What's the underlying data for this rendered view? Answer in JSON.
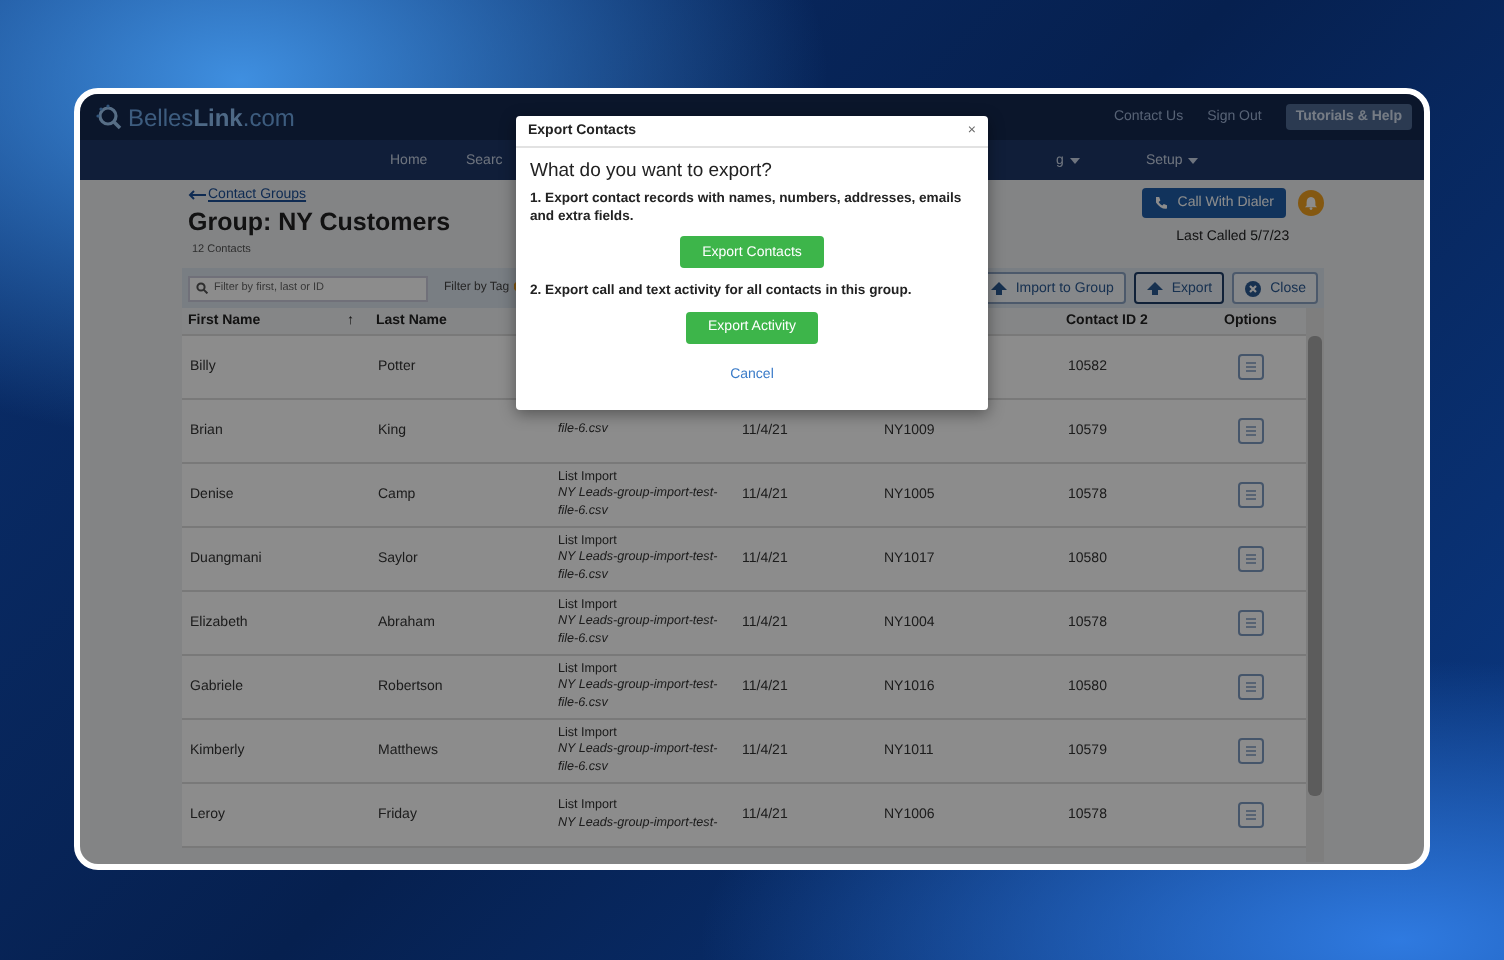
{
  "header": {
    "logo": "Belles**Link**.com",
    "links": [
      "Contact Us",
      "Sign Out"
    ],
    "help_button": "Tutorials & Help"
  },
  "nav": [
    {
      "label": "Home",
      "dropdown": false
    },
    {
      "label": "Searc",
      "dropdown": false
    },
    {
      "label": "g",
      "dropdown": true
    },
    {
      "label": "Setup",
      "dropdown": true
    }
  ],
  "page": {
    "back_link": "Contact Groups",
    "title": "Group: NY Customers",
    "count": "12 Contacts",
    "dialer_button": "Call With Dialer",
    "last_called": "Last Called 5/7/23"
  },
  "toolbar": {
    "search": {
      "placeholder": "Filter by first, last or ID"
    },
    "tag_filter": "Filter by Tag",
    "buttons": [
      {
        "kind": "import",
        "label": "Import to Group",
        "selected": false
      },
      {
        "kind": "export",
        "label": "Export",
        "selected": true
      },
      {
        "kind": "close",
        "label": "Close",
        "selected": false
      }
    ]
  },
  "table": {
    "columns": {
      "first_name": "First Name",
      "sort_indicator": "↑",
      "last_name": "Last Name",
      "contact_id_2": "Contact ID 2",
      "options": "Options"
    },
    "rows": [
      {
        "first_name": "Billy",
        "last_name": "Potter",
        "contact_id_2": "10582"
      },
      {
        "first_name": "Brian",
        "last_name": "King",
        "source_file": "file-6.csv",
        "date": "11/4/21",
        "id": "NY1009",
        "contact_id_2": "10579"
      },
      {
        "first_name": "Denise",
        "last_name": "Camp",
        "source": "List Import",
        "source_file": "NY Leads-group-import-test-file-6.csv",
        "date": "11/4/21",
        "id": "NY1005",
        "contact_id_2": "10578"
      },
      {
        "first_name": "Duangmani",
        "last_name": "Saylor",
        "source": "List Import",
        "source_file": "NY Leads-group-import-test-file-6.csv",
        "date": "11/4/21",
        "id": "NY1017",
        "contact_id_2": "10580"
      },
      {
        "first_name": "Elizabeth",
        "last_name": "Abraham",
        "source": "List Import",
        "source_file": "NY Leads-group-import-test-file-6.csv",
        "date": "11/4/21",
        "id": "NY1004",
        "contact_id_2": "10578"
      },
      {
        "first_name": "Gabriele",
        "last_name": "Robertson",
        "source": "List Import",
        "source_file": "NY Leads-group-import-test-file-6.csv",
        "date": "11/4/21",
        "id": "NY1016",
        "contact_id_2": "10580"
      },
      {
        "first_name": "Kimberly",
        "last_name": "Matthews",
        "source": "List Import",
        "source_file": "NY Leads-group-import-test-file-6.csv",
        "date": "11/4/21",
        "id": "NY1011",
        "contact_id_2": "10579"
      },
      {
        "first_name": "Leroy",
        "last_name": "Friday",
        "source": "List Import",
        "source_file": "NY Leads-group-import-test-",
        "date": "11/4/21",
        "id": "NY1006",
        "contact_id_2": "10578"
      }
    ]
  },
  "modal": {
    "title": "Export Contacts",
    "close": "×",
    "question": "What do you want to export?",
    "options": [
      {
        "text": "1. Export contact records with names, numbers, addresses, emails and extra fields.",
        "button": "Export Contacts"
      },
      {
        "text": "2. Export call and text activity for all contacts in this group.",
        "button": "Export Activity"
      }
    ],
    "cancel": "Cancel"
  }
}
